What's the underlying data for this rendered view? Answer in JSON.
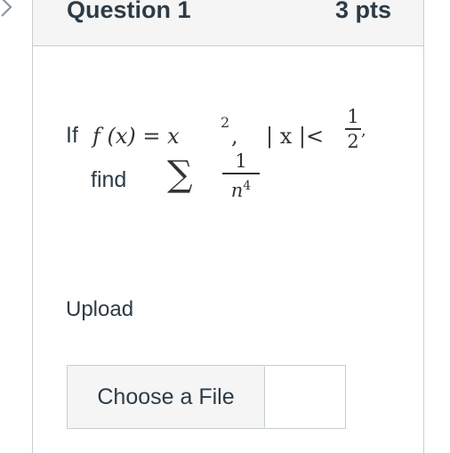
{
  "question": {
    "title": "Question 1",
    "points": "3 pts"
  },
  "stem": {
    "if_word": "If",
    "equation_lhs": "f (x) = x",
    "exponent": "2",
    "comma": ",",
    "condition": "| x |<",
    "frac_one_num": "1",
    "frac_one_den": "2",
    "condition_comma": ",",
    "find_word": "find",
    "sigma": "∑",
    "frac_two_num": "1",
    "frac_two_den_base": "n",
    "frac_two_den_exp": "4"
  },
  "upload": {
    "label": "Upload",
    "choose_button": "Choose a File",
    "filename": ""
  },
  "icons": {
    "back": "chevron-left-icon"
  },
  "colors": {
    "text": "#2d3b45",
    "border": "#c7cdd1",
    "header_bg": "#f5f5f5",
    "button_bg": "#f5f5f5"
  }
}
